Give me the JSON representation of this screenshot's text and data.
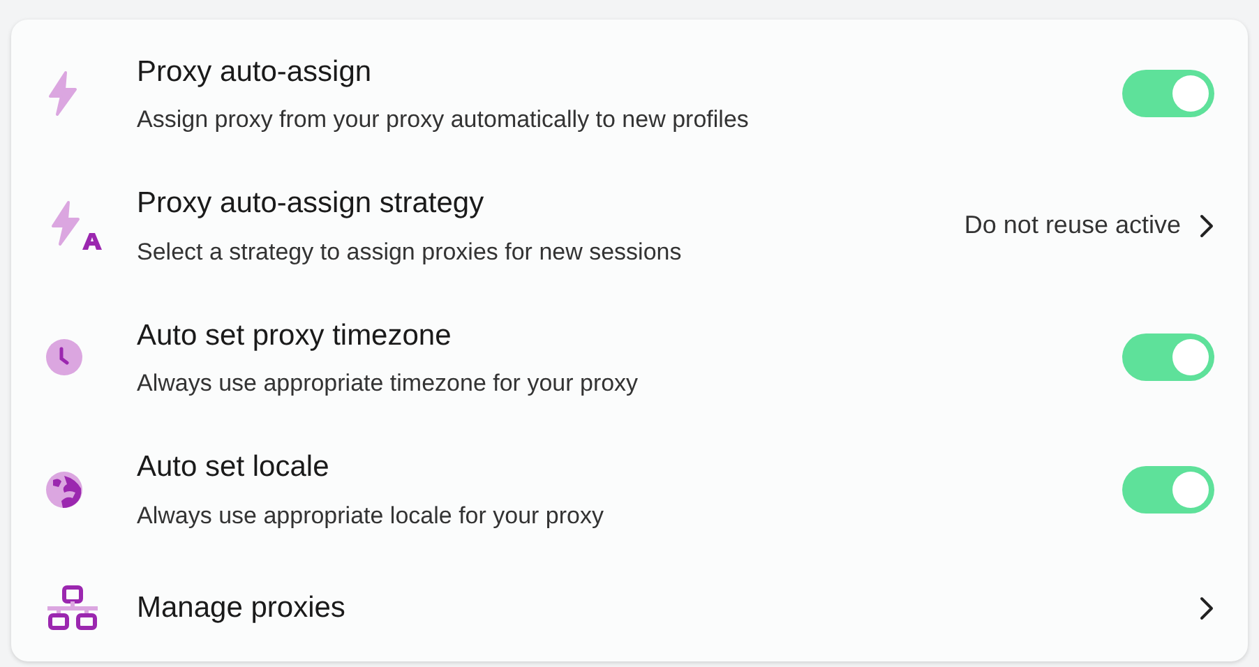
{
  "settings": [
    {
      "kind": "toggle",
      "title": "Proxy auto-assign",
      "description": "Assign proxy from your proxy automatically to new profiles",
      "on": true
    },
    {
      "kind": "link",
      "title": "Proxy auto-assign strategy",
      "description": "Select a strategy to assign proxies for new sessions",
      "value": "Do not reuse active"
    },
    {
      "kind": "toggle",
      "title": "Auto set proxy timezone",
      "description": "Always use appropriate timezone for your proxy",
      "on": true
    },
    {
      "kind": "toggle",
      "title": "Auto set locale",
      "description": "Always use appropriate locale for your proxy",
      "on": true
    },
    {
      "kind": "link",
      "title": "Manage proxies"
    }
  ]
}
